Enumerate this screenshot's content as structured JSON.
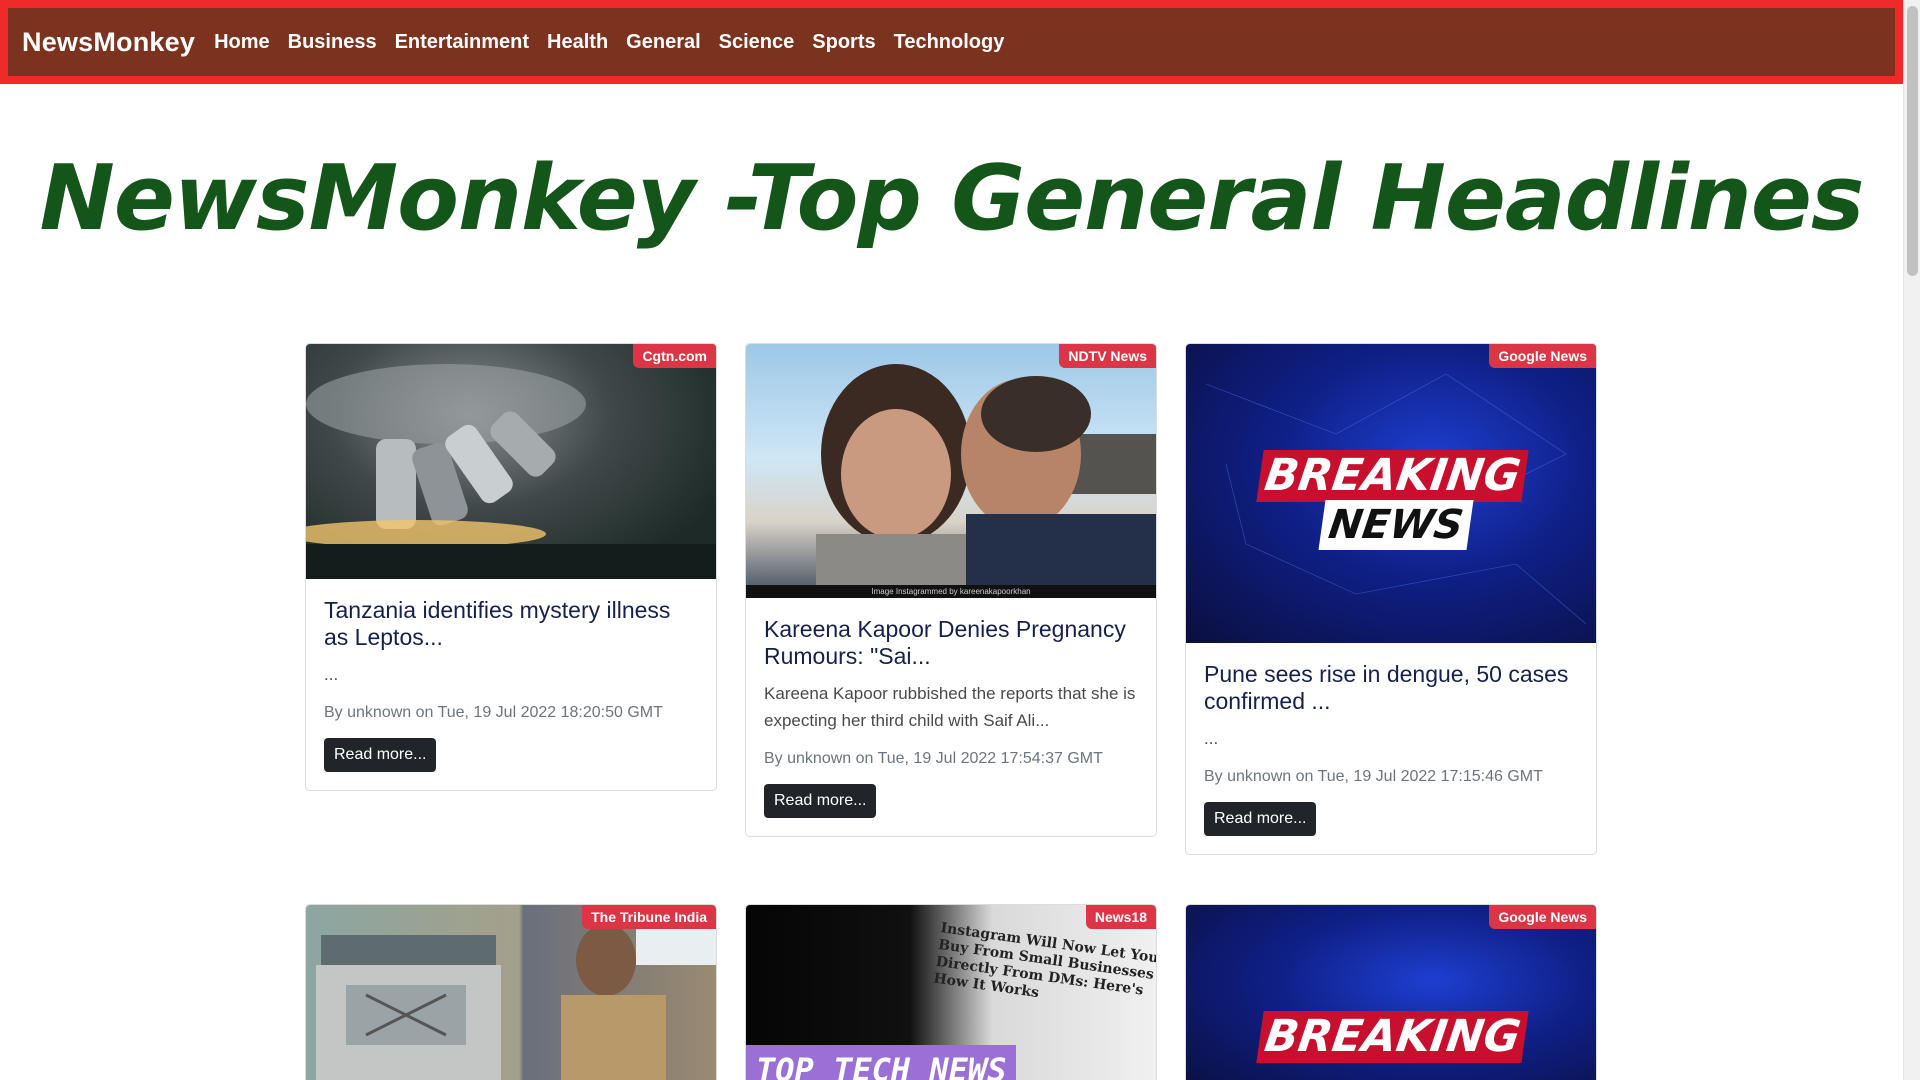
{
  "navbar": {
    "brand": "NewsMonkey",
    "links": [
      "Home",
      "Business",
      "Entertainment",
      "Health",
      "General",
      "Science",
      "Sports",
      "Technology"
    ]
  },
  "page_title": "NewsMonkey -Top General Headlines",
  "read_more_label": "Read more...",
  "cards": [
    {
      "source": "Cgtn.com",
      "title": "Tanzania identifies mystery illness as Leptos...",
      "description": "...",
      "meta": "By unknown on Tue, 19 Jul 2022 18:20:50 GMT",
      "image": "microscope-image"
    },
    {
      "source": "NDTV News",
      "title": "Kareena Kapoor Denies Pregnancy Rumours: \"Sai...",
      "description": "Kareena Kapoor rubbished the reports that she is expecting her third child with Saif Ali...",
      "meta": "By unknown on Tue, 19 Jul 2022 17:54:37 GMT",
      "image": "couple-photo-image",
      "image_caption": "Image Instagrammed by kareenakapoorkhan"
    },
    {
      "source": "Google News",
      "title": "Pune sees rise in dengue, 50 cases confirmed ...",
      "description": "...",
      "meta": "By unknown on Tue, 19 Jul 2022 17:15:46 GMT",
      "image": "breaking-news-image",
      "image_text_1": "BREAKING",
      "image_text_2": "NEWS"
    },
    {
      "source": "The Tribune India",
      "image": "truck-and-patient-image"
    },
    {
      "source": "News18",
      "image": "top-tech-news-image",
      "image_text_1": "TOP TECH NEWS",
      "image_text_2": "Instagram Will Now Let You Buy From Small Businesses Directly From DMs: Here's How It Works"
    },
    {
      "source": "Google News",
      "image": "breaking-news-image",
      "image_text_1": "BREAKING"
    }
  ]
}
